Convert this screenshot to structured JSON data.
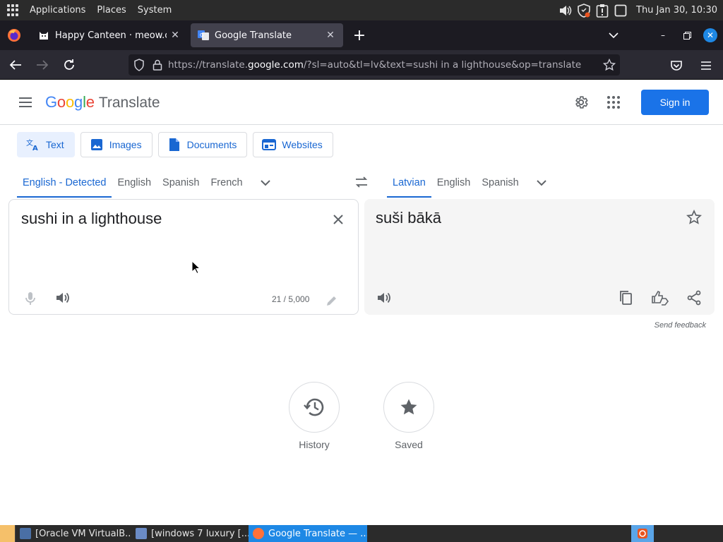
{
  "top_panel": {
    "menus": [
      "Applications",
      "Places",
      "System"
    ],
    "clock": "Thu Jan 30, 10:30"
  },
  "browser": {
    "tabs": [
      {
        "title": "Happy Canteen · meow.cam",
        "active": false
      },
      {
        "title": "Google Translate",
        "active": true
      }
    ],
    "url": {
      "prefix": "https://translate.",
      "host": "google.com",
      "path": "/?sl=auto&tl=lv&text=sushi in a lighthouse&op=translate"
    }
  },
  "translate": {
    "logo": {
      "google": "Google",
      "product": "Translate"
    },
    "sign_in": "Sign in",
    "modes": [
      "Text",
      "Images",
      "Documents",
      "Websites"
    ],
    "source_langs": [
      "English - Detected",
      "English",
      "Spanish",
      "French"
    ],
    "target_langs": [
      "Latvian",
      "English",
      "Spanish"
    ],
    "source_text": "sushi in a lighthouse",
    "char_count": "21 / 5,000",
    "translated_text": "suši bākā",
    "send_feedback": "Send feedback",
    "history_label": "History",
    "saved_label": "Saved"
  },
  "taskbar": {
    "tasks": [
      "[Oracle VM VirtualB...",
      "[windows 7 luxury [...",
      "Google Translate — ..."
    ]
  },
  "colors": {
    "accent": "#1a73e8",
    "active_text": "#1967d2"
  }
}
